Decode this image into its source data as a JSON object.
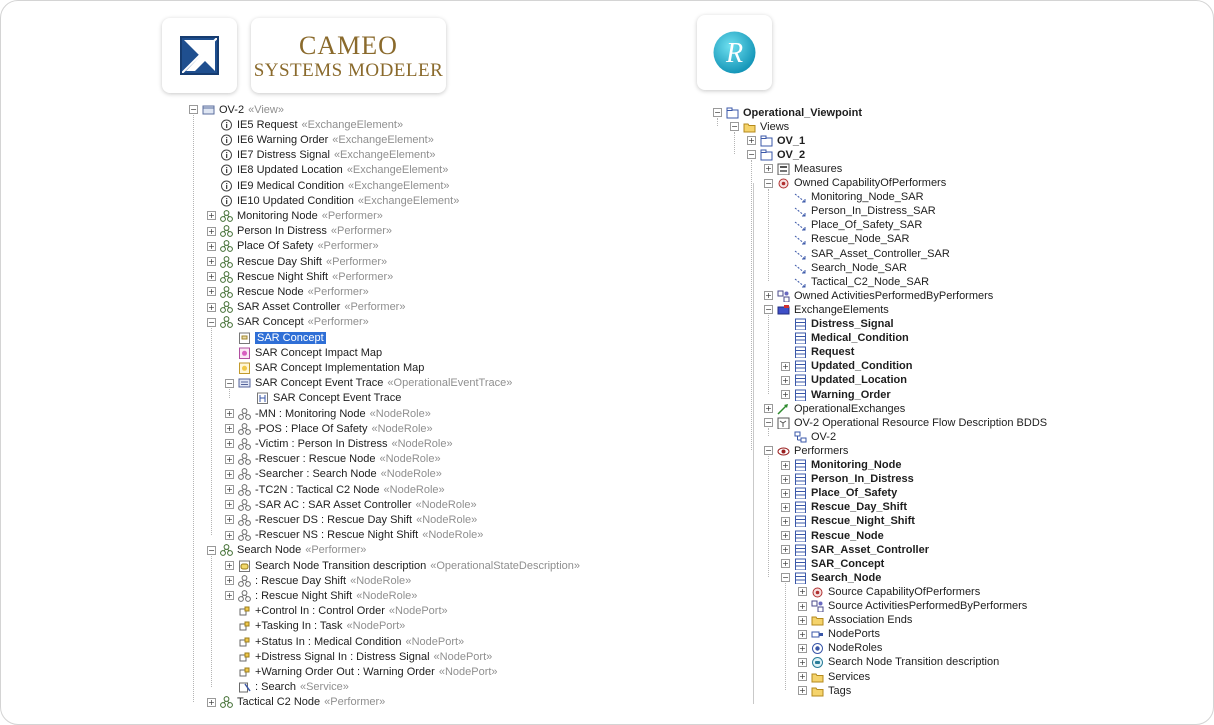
{
  "logos": {
    "cameo_line1": "CAMEO",
    "cameo_line2": "SYSTEMS MODELER",
    "rhapsody_letter": "R"
  },
  "left_tree": [
    {
      "label": "OV-2",
      "stereo": "«View»",
      "icon": "view-icon",
      "indent": 0,
      "exp": "-"
    },
    {
      "label": "IE5 Request",
      "stereo": "«ExchangeElement»",
      "icon": "info-icon",
      "indent": 1,
      "exp": ""
    },
    {
      "label": "IE6 Warning Order",
      "stereo": "«ExchangeElement»",
      "icon": "info-icon",
      "indent": 1,
      "exp": ""
    },
    {
      "label": "IE7 Distress Signal",
      "stereo": "«ExchangeElement»",
      "icon": "info-icon",
      "indent": 1,
      "exp": ""
    },
    {
      "label": "IE8 Updated Location",
      "stereo": "«ExchangeElement»",
      "icon": "info-icon",
      "indent": 1,
      "exp": ""
    },
    {
      "label": "IE9 Medical Condition",
      "stereo": "«ExchangeElement»",
      "icon": "info-icon",
      "indent": 1,
      "exp": ""
    },
    {
      "label": "IE10 Updated Condition",
      "stereo": "«ExchangeElement»",
      "icon": "info-icon",
      "indent": 1,
      "exp": ""
    },
    {
      "label": "Monitoring Node",
      "stereo": "«Performer»",
      "icon": "performer-icon",
      "indent": 1,
      "exp": "+"
    },
    {
      "label": "Person In Distress",
      "stereo": "«Performer»",
      "icon": "performer-icon",
      "indent": 1,
      "exp": "+"
    },
    {
      "label": "Place Of Safety",
      "stereo": "«Performer»",
      "icon": "performer-icon",
      "indent": 1,
      "exp": "+"
    },
    {
      "label": "Rescue Day Shift",
      "stereo": "«Performer»",
      "icon": "performer-icon",
      "indent": 1,
      "exp": "+"
    },
    {
      "label": "Rescue Night Shift",
      "stereo": "«Performer»",
      "icon": "performer-icon",
      "indent": 1,
      "exp": "+"
    },
    {
      "label": "Rescue Node",
      "stereo": "«Performer»",
      "icon": "performer-icon",
      "indent": 1,
      "exp": "+"
    },
    {
      "label": "SAR Asset Controller",
      "stereo": "«Performer»",
      "icon": "performer-icon",
      "indent": 1,
      "exp": "+"
    },
    {
      "label": "SAR Concept",
      "stereo": "«Performer»",
      "icon": "performer-icon",
      "indent": 1,
      "exp": "-"
    },
    {
      "label": "SAR Concept",
      "stereo": "",
      "icon": "diagram-icon",
      "indent": 2,
      "exp": "",
      "selected": true
    },
    {
      "label": "SAR Concept  Impact Map",
      "stereo": "",
      "icon": "impact-map-icon",
      "indent": 2,
      "exp": ""
    },
    {
      "label": "SAR Concept  Implementation Map",
      "stereo": "",
      "icon": "implementation-map-icon",
      "indent": 2,
      "exp": ""
    },
    {
      "label": "SAR Concept Event Trace",
      "stereo": "«OperationalEventTrace»",
      "icon": "event-trace-icon",
      "indent": 2,
      "exp": "-"
    },
    {
      "label": "SAR Concept Event Trace",
      "stereo": "",
      "icon": "sequence-diagram-icon",
      "indent": 3,
      "exp": ""
    },
    {
      "label": "-MN : Monitoring Node",
      "stereo": "«NodeRole»",
      "icon": "node-role-icon",
      "indent": 2,
      "exp": "+"
    },
    {
      "label": "-POS : Place Of Safety",
      "stereo": "«NodeRole»",
      "icon": "node-role-icon",
      "indent": 2,
      "exp": "+"
    },
    {
      "label": "-Victim : Person In Distress",
      "stereo": "«NodeRole»",
      "icon": "node-role-icon",
      "indent": 2,
      "exp": "+"
    },
    {
      "label": "-Rescuer : Rescue Node",
      "stereo": "«NodeRole»",
      "icon": "node-role-icon",
      "indent": 2,
      "exp": "+"
    },
    {
      "label": "-Searcher : Search Node",
      "stereo": "«NodeRole»",
      "icon": "node-role-icon",
      "indent": 2,
      "exp": "+"
    },
    {
      "label": "-TC2N : Tactical C2 Node",
      "stereo": "«NodeRole»",
      "icon": "node-role-icon",
      "indent": 2,
      "exp": "+"
    },
    {
      "label": "-SAR AC : SAR Asset Controller",
      "stereo": "«NodeRole»",
      "icon": "node-role-icon",
      "indent": 2,
      "exp": "+"
    },
    {
      "label": "-Rescuer DS : Rescue Day Shift",
      "stereo": "«NodeRole»",
      "icon": "node-role-icon",
      "indent": 2,
      "exp": "+"
    },
    {
      "label": "-Rescuer NS : Rescue Night Shift",
      "stereo": "«NodeRole»",
      "icon": "node-role-icon",
      "indent": 2,
      "exp": "+"
    },
    {
      "label": "Search Node",
      "stereo": "«Performer»",
      "icon": "performer-icon",
      "indent": 1,
      "exp": "-"
    },
    {
      "label": "Search Node Transition description",
      "stereo": "«OperationalStateDescription»",
      "icon": "state-diagram-icon",
      "indent": 2,
      "exp": "+"
    },
    {
      "label": ": Rescue Day Shift",
      "stereo": "«NodeRole»",
      "icon": "node-role-icon",
      "indent": 2,
      "exp": "+"
    },
    {
      "label": ": Rescue Night Shift",
      "stereo": "«NodeRole»",
      "icon": "node-role-icon",
      "indent": 2,
      "exp": "+"
    },
    {
      "label": "+Control In : Control Order",
      "stereo": "«NodePort»",
      "icon": "node-port-icon",
      "indent": 2,
      "exp": ""
    },
    {
      "label": "+Tasking In : Task",
      "stereo": "«NodePort»",
      "icon": "node-port-icon",
      "indent": 2,
      "exp": ""
    },
    {
      "label": "+Status In : Medical Condition",
      "stereo": "«NodePort»",
      "icon": "node-port-icon",
      "indent": 2,
      "exp": ""
    },
    {
      "label": "+Distress Signal In : Distress Signal",
      "stereo": "«NodePort»",
      "icon": "node-port-icon",
      "indent": 2,
      "exp": ""
    },
    {
      "label": "+Warning Order Out : Warning Order",
      "stereo": "«NodePort»",
      "icon": "node-port-icon",
      "indent": 2,
      "exp": ""
    },
    {
      "label": ": Search",
      "stereo": "«Service»",
      "icon": "service-icon",
      "indent": 2,
      "exp": ""
    },
    {
      "label": "Tactical C2 Node",
      "stereo": "«Performer»",
      "icon": "performer-icon",
      "indent": 1,
      "exp": "+"
    }
  ],
  "right_tree": [
    {
      "label": "Operational_Viewpoint",
      "icon": "package-icon",
      "indent": 0,
      "exp": "-",
      "bold": true
    },
    {
      "label": "Views",
      "icon": "folder-icon",
      "indent": 1,
      "exp": "-",
      "bold": false
    },
    {
      "label": "OV_1",
      "icon": "package-icon",
      "indent": 2,
      "exp": "+",
      "bold": true
    },
    {
      "label": "OV_2",
      "icon": "package-icon",
      "indent": 2,
      "exp": "-",
      "bold": true
    },
    {
      "label": "Measures",
      "icon": "measures-icon",
      "indent": 3,
      "exp": "+",
      "bold": false
    },
    {
      "label": "Owned CapabilityOfPerformers",
      "icon": "capability-icon",
      "indent": 3,
      "exp": "-",
      "bold": false
    },
    {
      "label": "Monitoring_Node_SAR",
      "icon": "dependency-icon",
      "indent": 4,
      "exp": "",
      "bold": false
    },
    {
      "label": "Person_In_Distress_SAR",
      "icon": "dependency-icon",
      "indent": 4,
      "exp": "",
      "bold": false
    },
    {
      "label": "Place_Of_Safety_SAR",
      "icon": "dependency-icon",
      "indent": 4,
      "exp": "",
      "bold": false
    },
    {
      "label": "Rescue_Node_SAR",
      "icon": "dependency-icon",
      "indent": 4,
      "exp": "",
      "bold": false
    },
    {
      "label": "SAR_Asset_Controller_SAR",
      "icon": "dependency-icon",
      "indent": 4,
      "exp": "",
      "bold": false
    },
    {
      "label": "Search_Node_SAR",
      "icon": "dependency-icon",
      "indent": 4,
      "exp": "",
      "bold": false
    },
    {
      "label": "Tactical_C2_Node_SAR",
      "icon": "dependency-icon",
      "indent": 4,
      "exp": "",
      "bold": false
    },
    {
      "label": "Owned ActivitiesPerformedByPerformers",
      "icon": "activities-icon",
      "indent": 3,
      "exp": "+",
      "bold": false
    },
    {
      "label": "ExchangeElements",
      "icon": "exchange-elements-icon",
      "indent": 3,
      "exp": "-",
      "bold": false
    },
    {
      "label": "Distress_Signal",
      "icon": "class-icon",
      "indent": 4,
      "exp": "",
      "bold": true
    },
    {
      "label": "Medical_Condition",
      "icon": "class-icon",
      "indent": 4,
      "exp": "",
      "bold": true
    },
    {
      "label": "Request",
      "icon": "class-icon",
      "indent": 4,
      "exp": "",
      "bold": true
    },
    {
      "label": "Updated_Condition",
      "icon": "class-icon",
      "indent": 4,
      "exp": "+",
      "bold": true
    },
    {
      "label": "Updated_Location",
      "icon": "class-icon",
      "indent": 4,
      "exp": "+",
      "bold": true
    },
    {
      "label": "Warning_Order",
      "icon": "class-icon",
      "indent": 4,
      "exp": "+",
      "bold": true
    },
    {
      "label": "OperationalExchanges",
      "icon": "exchange-arrow-icon",
      "indent": 3,
      "exp": "+",
      "bold": false
    },
    {
      "label": "OV-2 Operational Resource Flow Description BDDS",
      "icon": "bdd-icon",
      "indent": 3,
      "exp": "-",
      "bold": false
    },
    {
      "label": "OV-2",
      "icon": "diagram-link-icon",
      "indent": 4,
      "exp": "",
      "bold": false
    },
    {
      "label": "Performers",
      "icon": "eye-icon",
      "indent": 3,
      "exp": "-",
      "bold": false
    },
    {
      "label": "Monitoring_Node",
      "icon": "class-icon",
      "indent": 4,
      "exp": "+",
      "bold": true
    },
    {
      "label": "Person_In_Distress",
      "icon": "class-icon",
      "indent": 4,
      "exp": "+",
      "bold": true
    },
    {
      "label": "Place_Of_Safety",
      "icon": "class-icon",
      "indent": 4,
      "exp": "+",
      "bold": true
    },
    {
      "label": "Rescue_Day_Shift",
      "icon": "class-icon",
      "indent": 4,
      "exp": "+",
      "bold": true
    },
    {
      "label": "Rescue_Night_Shift",
      "icon": "class-icon",
      "indent": 4,
      "exp": "+",
      "bold": true
    },
    {
      "label": "Rescue_Node",
      "icon": "class-icon",
      "indent": 4,
      "exp": "+",
      "bold": true
    },
    {
      "label": "SAR_Asset_Controller",
      "icon": "class-icon",
      "indent": 4,
      "exp": "+",
      "bold": true
    },
    {
      "label": "SAR_Concept",
      "icon": "class-icon",
      "indent": 4,
      "exp": "+",
      "bold": true
    },
    {
      "label": "Search_Node",
      "icon": "class-icon",
      "indent": 4,
      "exp": "-",
      "bold": true
    },
    {
      "label": "Source CapabilityOfPerformers",
      "icon": "capability-icon",
      "indent": 5,
      "exp": "+",
      "bold": false
    },
    {
      "label": "Source ActivitiesPerformedByPerformers",
      "icon": "activities-icon",
      "indent": 5,
      "exp": "+",
      "bold": false
    },
    {
      "label": "Association Ends",
      "icon": "folder-icon",
      "indent": 5,
      "exp": "+",
      "bold": false
    },
    {
      "label": "NodePorts",
      "icon": "port-icon",
      "indent": 5,
      "exp": "+",
      "bold": false
    },
    {
      "label": "NodeRoles",
      "icon": "role-icon",
      "indent": 5,
      "exp": "+",
      "bold": false
    },
    {
      "label": "Search Node Transition description",
      "icon": "statechart-icon",
      "indent": 5,
      "exp": "+",
      "bold": false
    },
    {
      "label": "Services",
      "icon": "folder-icon",
      "indent": 5,
      "exp": "+",
      "bold": false
    },
    {
      "label": "Tags",
      "icon": "folder-icon",
      "indent": 5,
      "exp": "+",
      "bold": false
    }
  ]
}
